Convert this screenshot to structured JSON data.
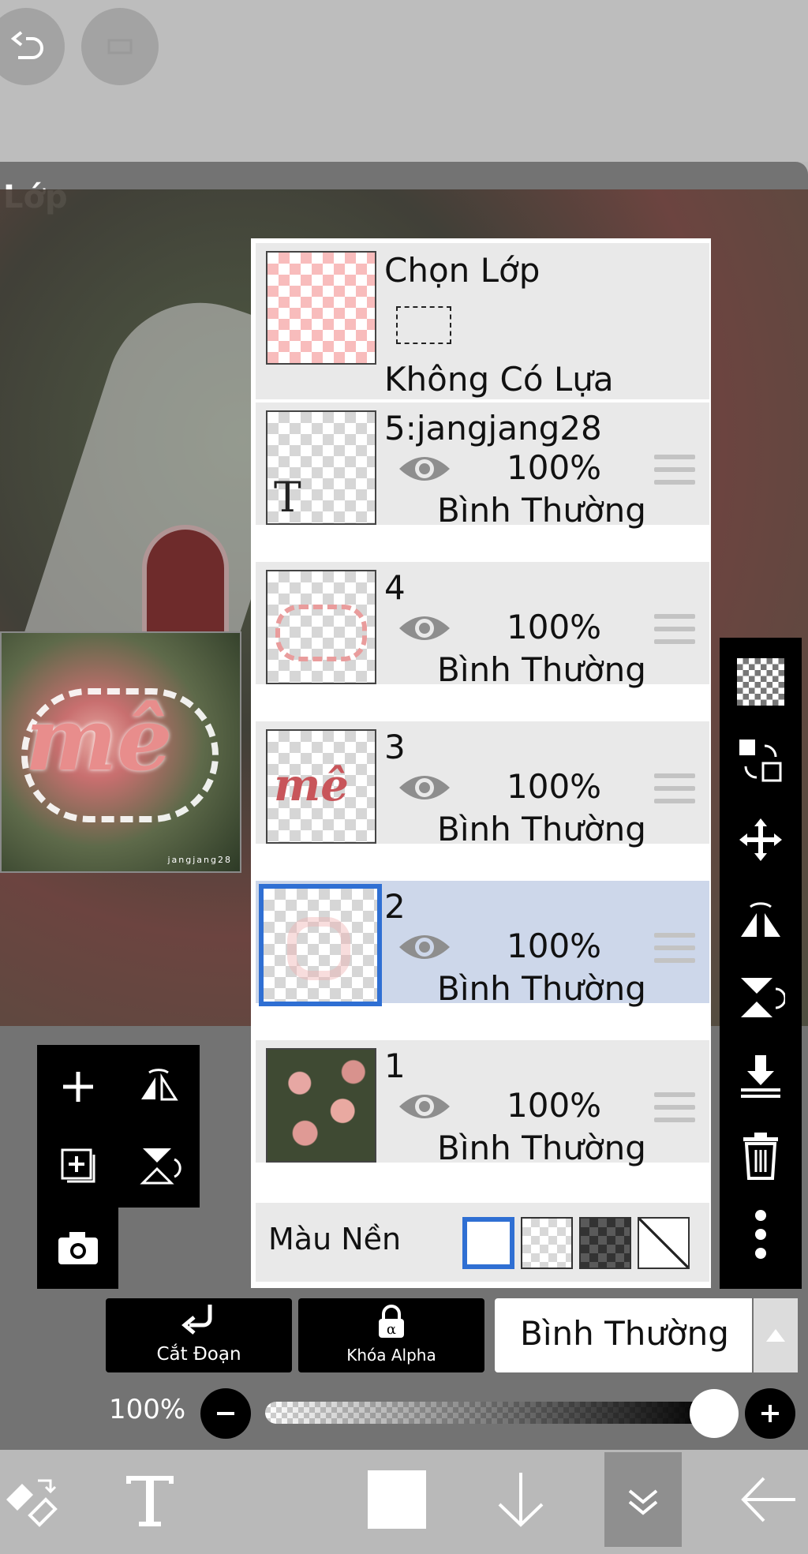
{
  "panel": {
    "title": "Lớp"
  },
  "selection": {
    "title": "Chọn Lớp",
    "status": "Không Có Lựa Chọn"
  },
  "layers": [
    {
      "name": "5:jangjang28",
      "opacity": "100%",
      "blend": "Bình Thường",
      "thumb_icon": "text-layer-icon",
      "selected": false
    },
    {
      "name": "4",
      "opacity": "100%",
      "blend": "Bình Thường",
      "selected": false
    },
    {
      "name": "3",
      "opacity": "100%",
      "blend": "Bình Thường",
      "thumb_text": "mê",
      "selected": false
    },
    {
      "name": "2",
      "opacity": "100%",
      "blend": "Bình Thường",
      "selected": true
    },
    {
      "name": "1",
      "opacity": "100%",
      "blend": "Bình Thường",
      "selected": false
    }
  ],
  "background": {
    "label": "Màu Nền",
    "selected_swatch": "white"
  },
  "preview": {
    "word": "mê"
  },
  "controls": {
    "clip_label": "Cắt Đoạn",
    "alpha_lock_label": "Khóa Alpha",
    "blend_mode": "Bình Thường",
    "opacity_label": "100%",
    "opacity_value": 1.0
  },
  "thumb_text_glyph": "T",
  "colors": {
    "selected_row": "#cdd7ea",
    "selected_border": "#2f6fd3",
    "panel": "#737373"
  }
}
